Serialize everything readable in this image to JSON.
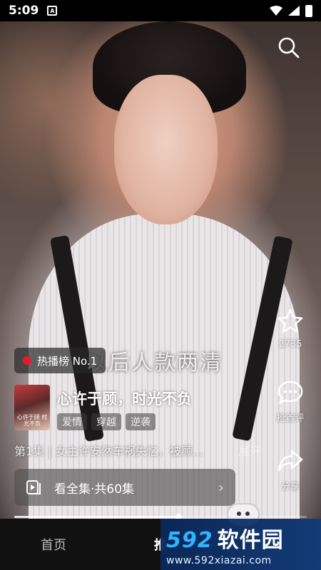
{
  "status_bar": {
    "time": "5:09",
    "app_icon": "A"
  },
  "overlay": {
    "subtitle": "以后人款两清"
  },
  "rank": {
    "label": "热播榜 No.1"
  },
  "drama": {
    "poster_text": "心许于顾 时光不负",
    "title": "心许于顾，时光不负",
    "tags": [
      "爱情",
      "穿越",
      "逆袭"
    ],
    "episode_desc": "第1集 | 女主许安然车祸失忆，被顾...",
    "expand_label": "展开",
    "watch_all_label": "看全集·共60集"
  },
  "actions": {
    "favorite_count": "2735",
    "comment_label": "抢首评",
    "share_label": "分享"
  },
  "progress": {
    "fraction": 0.56
  },
  "bottom_nav": {
    "items": [
      "首页",
      "推",
      ""
    ]
  },
  "watermark": {
    "number": "592",
    "name": "软件园",
    "url": "www.592xiazai.com"
  }
}
